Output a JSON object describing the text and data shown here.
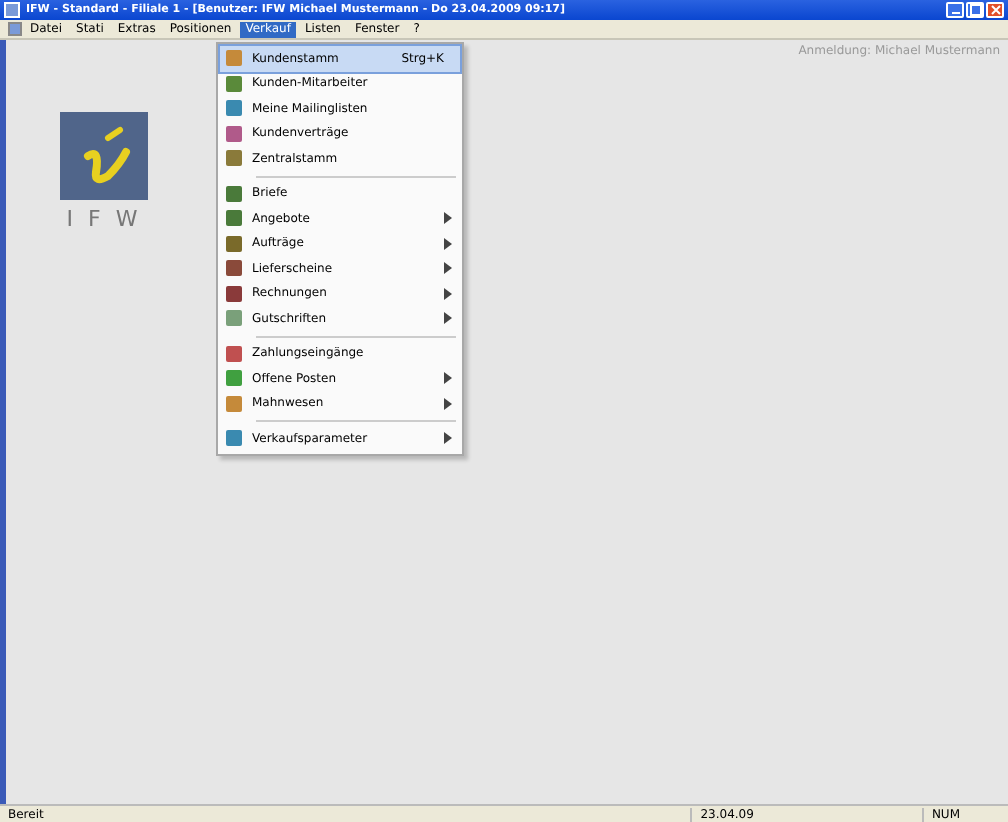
{
  "window": {
    "title": "IFW - Standard - Filiale 1 - [Benutzer: IFW Michael Mustermann - Do 23.04.2009 09:17]"
  },
  "menu_bar": [
    {
      "label": "Datei",
      "selected": false
    },
    {
      "label": "Stati",
      "selected": false
    },
    {
      "label": "Extras",
      "selected": false
    },
    {
      "label": "Positionen",
      "selected": false
    },
    {
      "label": "Verkauf",
      "selected": true
    },
    {
      "label": "Listen",
      "selected": false
    },
    {
      "label": "Fenster",
      "selected": false
    },
    {
      "label": "?",
      "selected": false
    }
  ],
  "login_info": "Anmeldung: Michael Mustermann",
  "logo": {
    "text": "I F W"
  },
  "dropdown": [
    {
      "kind": "item",
      "label": "Kundenstamm",
      "shortcut": "Strg+K",
      "submenu": false,
      "selected": true
    },
    {
      "kind": "item",
      "label": "Kunden-Mitarbeiter",
      "submenu": false,
      "selected": false
    },
    {
      "kind": "item",
      "label": "Meine Mailinglisten",
      "submenu": false,
      "selected": false
    },
    {
      "kind": "item",
      "label": "Kundenverträge",
      "submenu": false,
      "selected": false
    },
    {
      "kind": "item",
      "label": "Zentralstamm",
      "submenu": false,
      "selected": false
    },
    {
      "kind": "separator"
    },
    {
      "kind": "item",
      "label": "Briefe",
      "submenu": false,
      "selected": false
    },
    {
      "kind": "item",
      "label": "Angebote",
      "submenu": true,
      "selected": false
    },
    {
      "kind": "item",
      "label": "Aufträge",
      "submenu": true,
      "selected": false
    },
    {
      "kind": "item",
      "label": "Lieferscheine",
      "submenu": true,
      "selected": false
    },
    {
      "kind": "item",
      "label": "Rechnungen",
      "submenu": true,
      "selected": false
    },
    {
      "kind": "item",
      "label": "Gutschriften",
      "submenu": true,
      "selected": false
    },
    {
      "kind": "separator"
    },
    {
      "kind": "item",
      "label": "Zahlungseingänge",
      "submenu": false,
      "selected": false
    },
    {
      "kind": "item",
      "label": "Offene Posten",
      "submenu": true,
      "selected": false
    },
    {
      "kind": "item",
      "label": "Mahnwesen",
      "submenu": true,
      "selected": false
    },
    {
      "kind": "separator"
    },
    {
      "kind": "item",
      "label": "Verkaufsparameter",
      "submenu": true,
      "selected": false
    }
  ],
  "status_bar": {
    "left": "Bereit",
    "middle": "23.04.09",
    "right": "NUM"
  }
}
